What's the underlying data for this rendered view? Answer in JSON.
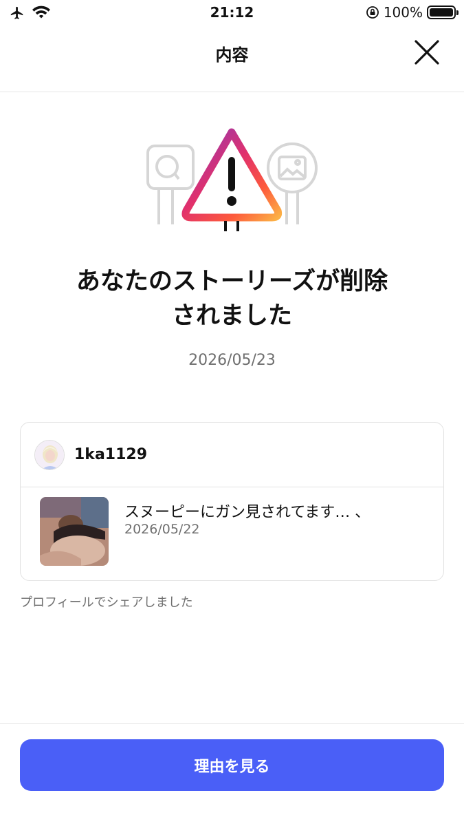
{
  "status_bar": {
    "time": "21:12",
    "battery_text": "100%",
    "battery_level": 1.0,
    "icons": [
      "airplane-icon",
      "wifi-icon",
      "rotation-lock-icon",
      "battery-icon"
    ]
  },
  "header": {
    "title": "内容",
    "close_icon": "close-icon"
  },
  "illustration": {
    "icon": "warning-triangle-icon",
    "gradient": [
      "#8a3ab9",
      "#e1306c",
      "#fd7e23",
      "#fcb045"
    ]
  },
  "notice": {
    "title_line1": "あなたのストーリーズが削除",
    "title_line2": "されました",
    "date": "2026/05/23"
  },
  "card": {
    "username": "1ka1129",
    "story_caption": "スヌーピーにガン見されてます… 、",
    "story_date": "2026/05/22"
  },
  "shared_note": "プロフィールでシェアしました",
  "button": {
    "label": "理由を見る",
    "color": "#4a5ff7"
  }
}
